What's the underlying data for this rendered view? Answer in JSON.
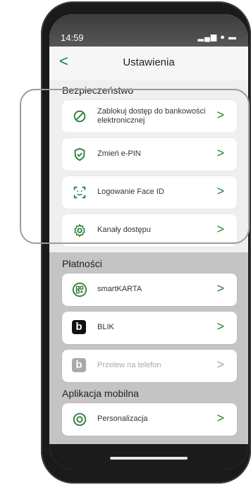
{
  "status": {
    "time": "14:59",
    "icons": "▂▄▆ ● ▬"
  },
  "header": {
    "back_label": "<",
    "title": "Ustawienia"
  },
  "sections": [
    {
      "title": "Bezpieczeństwo",
      "items": [
        {
          "label": "Zablokuj dostęp do bankowości elektronicznej",
          "icon": "block-icon"
        },
        {
          "label": "Zmień e-PIN",
          "icon": "shield-check-icon"
        },
        {
          "label": "Logowanie Face ID",
          "icon": "face-id-icon"
        },
        {
          "label": "Kanały dostępu",
          "icon": "gear-icon"
        }
      ]
    },
    {
      "title": "Płatności",
      "items": [
        {
          "label": "smartKARTA",
          "icon": "qr-code-icon"
        },
        {
          "label": "BLIK",
          "icon": "blik-logo-icon"
        },
        {
          "label": "Przelew na telefon",
          "icon": "blik-logo-icon",
          "disabled": true
        }
      ]
    },
    {
      "title": "Aplikacja mobilna",
      "items": [
        {
          "label": "Personalizacja",
          "icon": "personalization-icon"
        }
      ]
    }
  ],
  "chevron": ">",
  "blik_letter": "b",
  "colors": {
    "accent": "#2e7d32"
  }
}
